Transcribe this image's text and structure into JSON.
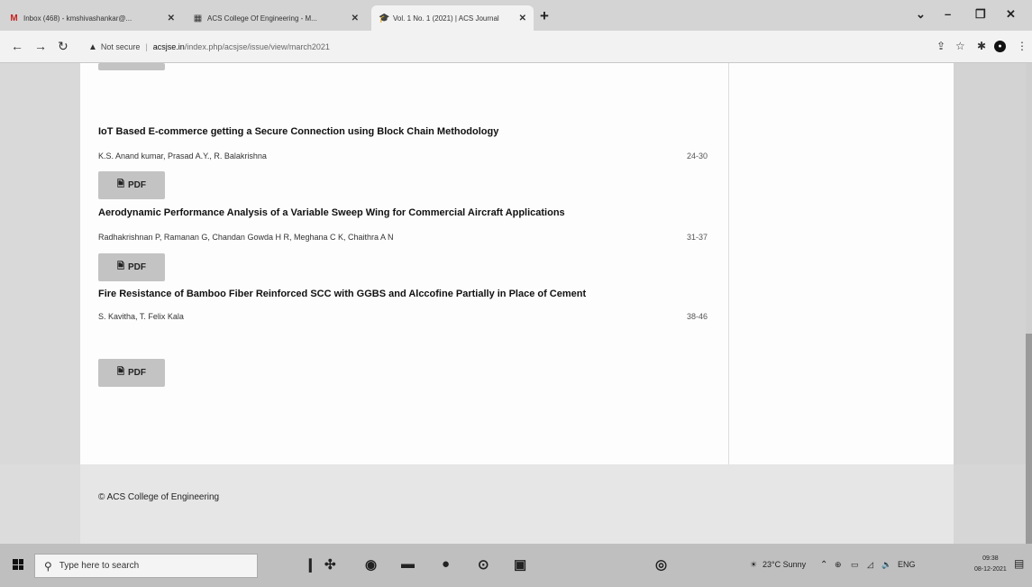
{
  "browser": {
    "tabs": [
      {
        "label": "Inbox (468) - kmshivashankar@...",
        "icon": "gmail-icon",
        "active": false
      },
      {
        "label": "ACS College Of Engineering - M...",
        "icon": "college-logo-icon",
        "active": false
      },
      {
        "label": "Vol. 1 No. 1 (2021) | ACS Journal",
        "icon": "journal-icon",
        "active": true
      }
    ],
    "new_tab": "+",
    "security_label": "Not secure",
    "url_domain": "acsjse.in",
    "url_path": "/index.php/acsjse/issue/view/march2021"
  },
  "articles": [
    {
      "title": "IoT Based E-commerce getting a Secure Connection using Block Chain Methodology",
      "authors": "K.S. Anand kumar, Prasad A.Y., R. Balakrishna",
      "pages": "24-30",
      "pdf_label": "PDF"
    },
    {
      "title": "Aerodynamic Performance Analysis of a Variable Sweep Wing for Commercial Aircraft Applications",
      "authors": "Radhakrishnan P, Ramanan G, Chandan Gowda H R, Meghana C K, Chaithra A N",
      "pages": "31-37",
      "pdf_label": "PDF"
    },
    {
      "title": "Fire Resistance of Bamboo Fiber Reinforced SCC with GGBS and Alccofine Partially in Place of Cement",
      "authors": "S. Kavitha, T. Felix Kala",
      "pages": "38-46",
      "pdf_label": "PDF"
    }
  ],
  "footer": {
    "copyright": "© ACS College of Engineering"
  },
  "taskbar": {
    "search_placeholder": "Type here to search",
    "weather": "23°C Sunny",
    "language": "ENG",
    "time": "09:38",
    "date": "08-12-2021"
  }
}
